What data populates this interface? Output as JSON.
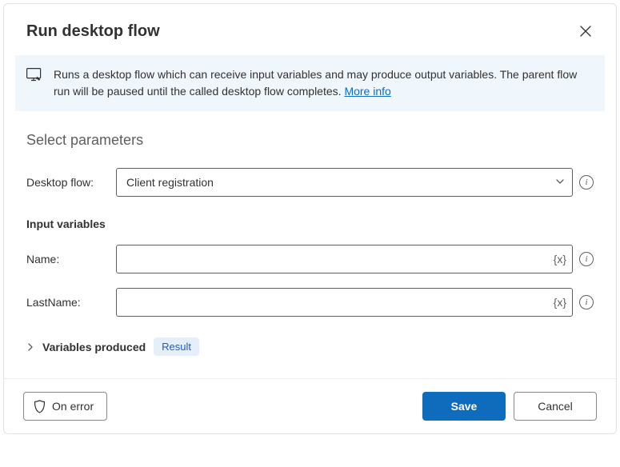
{
  "dialog": {
    "title": "Run desktop flow"
  },
  "info": {
    "text": "Runs a desktop flow which can receive input variables and may produce output variables. The parent flow run will be paused until the called desktop flow completes. ",
    "more_label": "More info"
  },
  "parameters": {
    "section_title": "Select parameters",
    "desktop_flow_label": "Desktop flow:",
    "desktop_flow_value": "Client registration",
    "input_vars_title": "Input variables",
    "fields": [
      {
        "label": "Name:",
        "value": ""
      },
      {
        "label": "LastName:",
        "value": ""
      }
    ],
    "vars_produced_label": "Variables produced",
    "vars_produced_pill": "Result"
  },
  "footer": {
    "on_error_label": "On error",
    "save_label": "Save",
    "cancel_label": "Cancel"
  }
}
